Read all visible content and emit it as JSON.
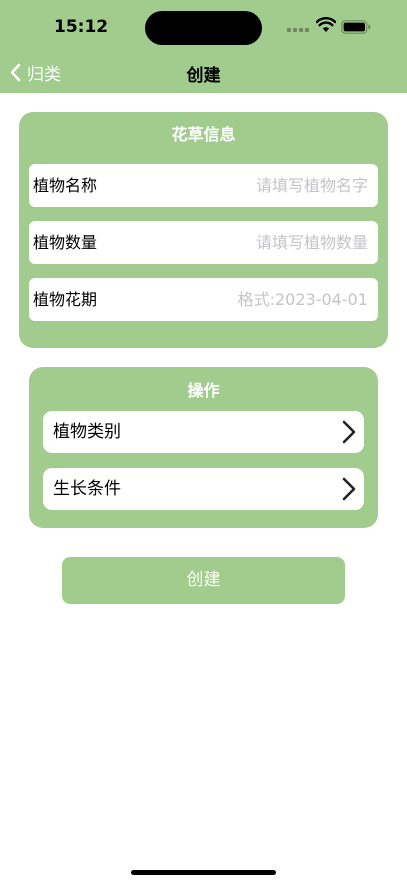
{
  "status_bar": {
    "time": "15:12"
  },
  "nav": {
    "back_label": "归类",
    "title": "创建"
  },
  "info_card": {
    "title": "花草信息",
    "fields": [
      {
        "label": "植物名称",
        "placeholder": "请填写植物名字",
        "value": ""
      },
      {
        "label": "植物数量",
        "placeholder": "请填写植物数量",
        "value": ""
      },
      {
        "label": "植物花期",
        "placeholder": "格式:2023-04-01",
        "value": ""
      }
    ]
  },
  "actions_card": {
    "title": "操作",
    "rows": [
      {
        "label": "植物类别"
      },
      {
        "label": "生长条件"
      }
    ]
  },
  "create_button": {
    "label": "创建"
  },
  "colors": {
    "accent": "#a2cc8d",
    "placeholder": "#c4c4c8",
    "background": "#ffffff"
  },
  "icons": [
    "back-chevron-icon",
    "signal-icon",
    "wifi-icon",
    "battery-icon",
    "chevron-right-icon"
  ]
}
